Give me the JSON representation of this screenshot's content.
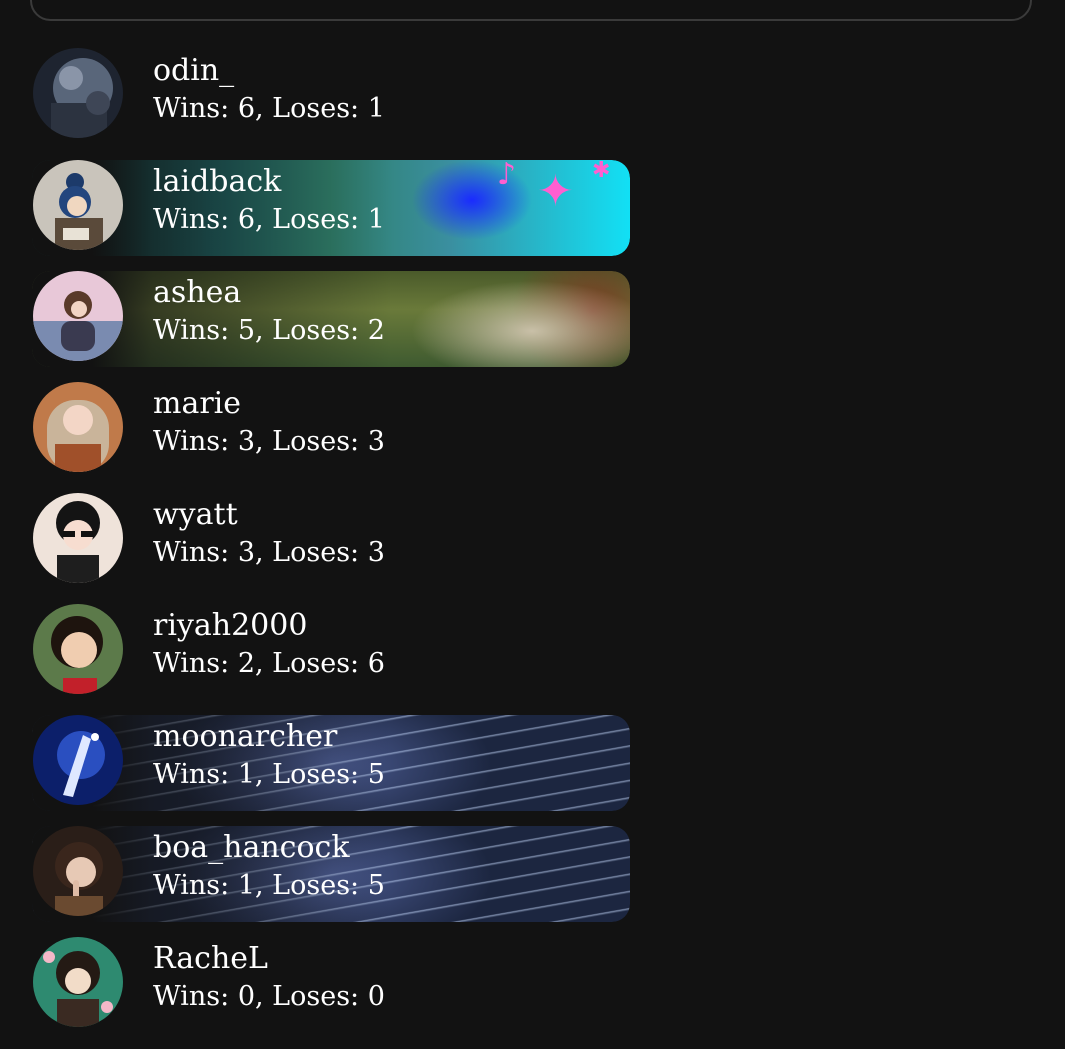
{
  "players": [
    {
      "name": "odin_",
      "stats": "Wins: 6, Loses: 1",
      "banner": "none",
      "avatar": "odin-avatar"
    },
    {
      "name": "laidback",
      "stats": "Wins: 6, Loses: 1",
      "banner": "sky",
      "avatar": "laidback-avatar"
    },
    {
      "name": "ashea",
      "stats": "Wins: 5, Loses: 2",
      "banner": "meadow",
      "avatar": "ashea-avatar"
    },
    {
      "name": "marie",
      "stats": "Wins: 3, Loses: 3",
      "banner": "none",
      "avatar": "marie-avatar"
    },
    {
      "name": "wyatt",
      "stats": "Wins: 3, Loses: 3",
      "banner": "none",
      "avatar": "wyatt-avatar"
    },
    {
      "name": "riyah2000",
      "stats": "Wins: 2, Loses: 6",
      "banner": "none",
      "avatar": "riyah2000-avatar"
    },
    {
      "name": "moonarcher",
      "stats": "Wins: 1, Loses: 5",
      "banner": "space",
      "avatar": "moonarcher-avatar"
    },
    {
      "name": "boa_hancock",
      "stats": "Wins: 1, Loses: 5",
      "banner": "space",
      "avatar": "boa-hancock-avatar"
    },
    {
      "name": "RacheL",
      "stats": "Wins: 0, Loses: 0",
      "banner": "none",
      "avatar": "rachel-avatar"
    }
  ],
  "colors": {
    "background": "#121212",
    "text": "#ffffff",
    "top_box_border": "#3a3a3a"
  }
}
